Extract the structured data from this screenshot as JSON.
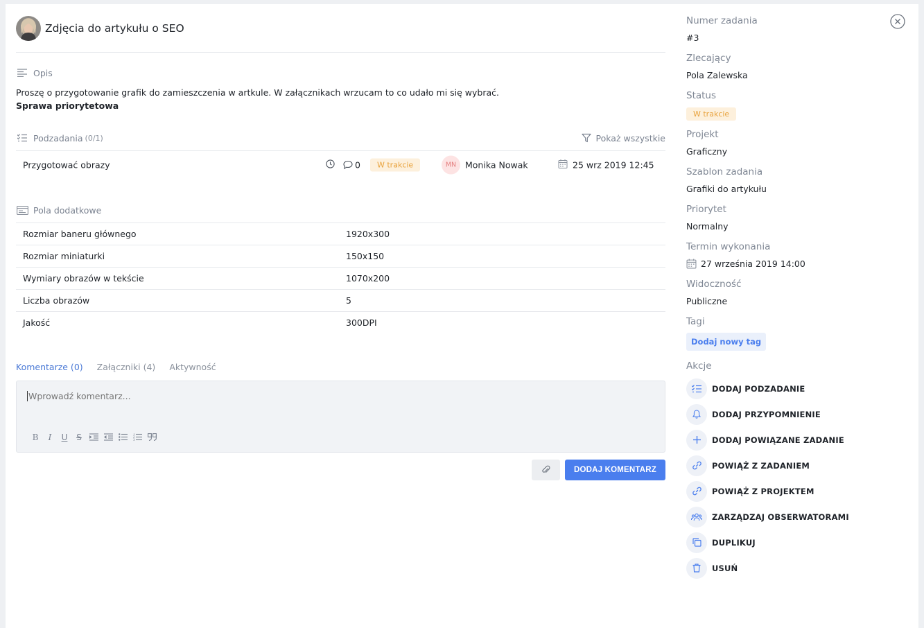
{
  "task": {
    "title": "Zdjęcia do artykułu o SEO"
  },
  "description": {
    "heading": "Opis",
    "text": "Proszę o przygotowanie grafik do zamieszczenia w artkule. W załącznikach wrzucam to co udało mi się wybrać.",
    "bold_text": "Sprawa priorytetowa"
  },
  "subtasks": {
    "heading": "Podzadania",
    "count": "(0/1)",
    "show_all": "Pokaż wszystkie",
    "items": [
      {
        "name": "Przygotować obrazy",
        "comments": "0",
        "status": "W trakcie",
        "assignee_initials": "MN",
        "assignee": "Monika Nowak",
        "date": "25 wrz 2019 12:45"
      }
    ]
  },
  "fields": {
    "heading": "Pola dodatkowe",
    "rows": [
      {
        "label": "Rozmiar baneru głównego",
        "value": "1920x300"
      },
      {
        "label": "Rozmiar miniaturki",
        "value": "150x150"
      },
      {
        "label": "Wymiary obrazów w tekście",
        "value": "1070x200"
      },
      {
        "label": "Liczba obrazów",
        "value": "5"
      },
      {
        "label": "Jakość",
        "value": "300DPI"
      }
    ]
  },
  "tabs": [
    {
      "label": "Komentarze (0)",
      "active": true
    },
    {
      "label": "Załączniki (4)",
      "active": false
    },
    {
      "label": "Aktywność",
      "active": false
    }
  ],
  "comment": {
    "placeholder": "Wprowadź komentarz...",
    "submit_label": "DODAJ KOMENTARZ",
    "tools": [
      "bold-icon",
      "italic-icon",
      "underline-icon",
      "strikethrough-icon",
      "indent-icon",
      "outdent-icon",
      "bullet-list-icon",
      "numbered-list-icon",
      "quote-icon"
    ]
  },
  "sidebar": {
    "task_number_label": "Numer zadania",
    "task_number": "#3",
    "requester_label": "Zlecający",
    "requester": "Pola Zalewska",
    "status_label": "Status",
    "status": "W trakcie",
    "project_label": "Projekt",
    "project": "Graficzny",
    "template_label": "Szablon zadania",
    "template": "Grafiki do artykułu",
    "priority_label": "Priorytet",
    "priority": "Normalny",
    "deadline_label": "Termin wykonania",
    "deadline": "27 września 2019 14:00",
    "visibility_label": "Widoczność",
    "visibility": "Publiczne",
    "tags_label": "Tagi",
    "add_tag": "Dodaj nowy tag",
    "actions_label": "Akcje",
    "actions": [
      {
        "label": "DODAJ PODZADANIE",
        "icon": "checklist-icon"
      },
      {
        "label": "DODAJ PRZYPOMNIENIE",
        "icon": "bell-icon"
      },
      {
        "label": "DODAJ POWIĄZANE ZADANIE",
        "icon": "plus-icon"
      },
      {
        "label": "POWIĄŻ Z ZADANIEM",
        "icon": "link-icon"
      },
      {
        "label": "POWIĄŻ Z PROJEKTEM",
        "icon": "link-icon"
      },
      {
        "label": "ZARZĄDZAJ OBSERWATORAMI",
        "icon": "users-icon"
      },
      {
        "label": "DUPLIKUJ",
        "icon": "copy-icon"
      },
      {
        "label": "USUŃ",
        "icon": "trash-icon"
      }
    ]
  },
  "colors": {
    "accent": "#4a7eee",
    "status_bg": "#fdf0dc",
    "status_text": "#e8a23c"
  }
}
